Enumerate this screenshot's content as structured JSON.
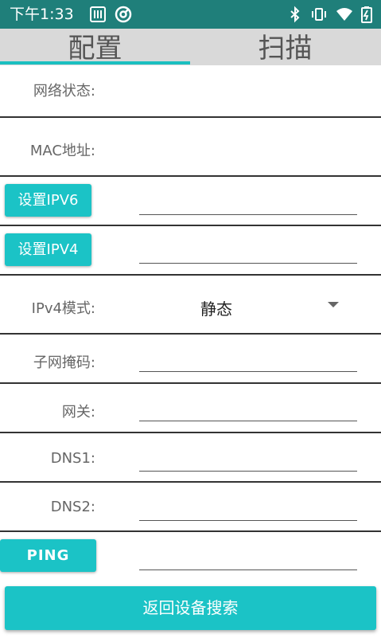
{
  "status_bar": {
    "time": "下午1:33",
    "icons": [
      "sim-card-icon",
      "at-sign-icon",
      "bluetooth-icon",
      "vibrate-icon",
      "wifi-icon",
      "battery-charging-icon"
    ]
  },
  "tabs": [
    {
      "label": "配置",
      "active": true
    },
    {
      "label": "扫描",
      "active": false
    }
  ],
  "form": {
    "network_status_label": "网络状态:",
    "mac_label": "MAC地址:",
    "set_ipv6_label": "设置IPV6",
    "set_ipv4_label": "设置IPV4",
    "ipv4_mode_label": "IPv4模式:",
    "ipv4_mode_value": "静态",
    "subnet_label": "子网掩码:",
    "gateway_label": "网关:",
    "dns1_label": "DNS1:",
    "dns2_label": "DNS2:",
    "ping_label": "PING"
  },
  "actions": {
    "back_label": "返回设备搜索"
  },
  "colors": {
    "status_bar": "#1f7f7a",
    "accent": "#1bc3c6",
    "tab_bg": "#d9d9d9"
  }
}
